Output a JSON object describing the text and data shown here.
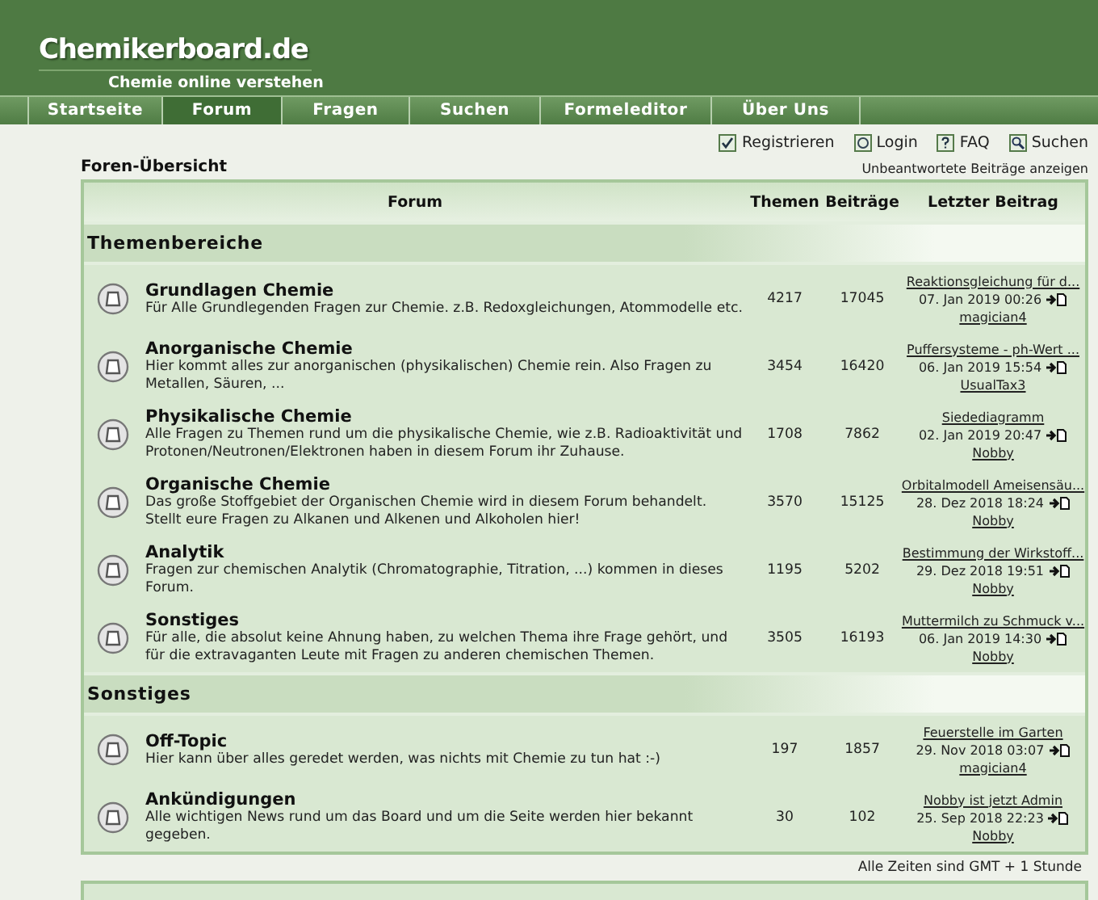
{
  "site": {
    "title": "Chemikerboard.de",
    "tagline": "Chemie online verstehen"
  },
  "nav": [
    {
      "label": "Startseite",
      "selected": false
    },
    {
      "label": "Forum",
      "selected": true
    },
    {
      "label": "Fragen",
      "selected": false
    },
    {
      "label": "Suchen",
      "selected": false
    },
    {
      "label": "Formeleditor",
      "selected": false
    },
    {
      "label": "Über Uns",
      "selected": false
    }
  ],
  "top_links": [
    {
      "label": "Registrieren",
      "kind": "register"
    },
    {
      "label": "Login",
      "kind": "login"
    },
    {
      "label": "FAQ",
      "kind": "faq"
    },
    {
      "label": "Suchen",
      "kind": "search"
    }
  ],
  "page_title": "Foren-Übersicht",
  "unanswered_link": "Unbeantwortete Beiträge anzeigen",
  "table": {
    "columns": [
      "Forum",
      "Themen",
      "Beiträge",
      "Letzter Beitrag"
    ],
    "categories": [
      {
        "title": "Themenbereiche",
        "forums": [
          {
            "title": "Grundlagen Chemie",
            "description": "Für Alle Grundlegenden Fragen zur Chemie. z.B. Redoxgleichungen, Atommodelle etc.",
            "topics": "4217",
            "posts": "17045",
            "last_post": {
              "title": "Reaktionsgleichung für d...",
              "date": "07. Jan 2019 00:26",
              "user": "magician4"
            }
          },
          {
            "title": "Anorganische Chemie",
            "description": "Hier kommt alles zur anorganischen (physikalischen) Chemie rein. Also Fragen zu Metallen, Säuren, ...",
            "topics": "3454",
            "posts": "16420",
            "last_post": {
              "title": "Puffersysteme - ph-Wert ...",
              "date": "06. Jan 2019 15:54",
              "user": "UsualTax3"
            }
          },
          {
            "title": "Physikalische Chemie",
            "description": "Alle Fragen zu Themen rund um die physikalische Chemie, wie z.B. Radioaktivität und Protonen/Neutronen/Elektronen haben in diesem Forum ihr Zuhause.",
            "topics": "1708",
            "posts": "7862",
            "last_post": {
              "title": "Siedediagramm",
              "date": "02. Jan 2019 20:47",
              "user": "Nobby"
            }
          },
          {
            "title": "Organische Chemie",
            "description": "Das große Stoffgebiet der Organischen Chemie wird in diesem Forum behandelt. Stellt eure Fragen zu Alkanen und Alkenen und Alkoholen hier!",
            "topics": "3570",
            "posts": "15125",
            "last_post": {
              "title": "Orbitalmodell Ameisensäu...",
              "date": "28. Dez 2018 18:24",
              "user": "Nobby"
            }
          },
          {
            "title": "Analytik",
            "description": "Fragen zur chemischen Analytik (Chromatographie, Titration, ...) kommen in dieses Forum.",
            "topics": "1195",
            "posts": "5202",
            "last_post": {
              "title": "Bestimmung der Wirkstoff...",
              "date": "29. Dez 2018 19:51",
              "user": "Nobby"
            }
          },
          {
            "title": "Sonstiges",
            "description": "Für alle, die absolut keine Ahnung haben, zu welchen Thema ihre Frage gehört, und für die extravaganten Leute mit Fragen zu anderen chemischen Themen.",
            "topics": "3505",
            "posts": "16193",
            "last_post": {
              "title": "Muttermilch zu Schmuck v...",
              "date": "06. Jan 2019 14:30",
              "user": "Nobby"
            }
          }
        ]
      },
      {
        "title": "Sonstiges",
        "forums": [
          {
            "title": "Off-Topic",
            "description": "Hier kann über alles geredet werden, was nichts mit Chemie zu tun hat :-)",
            "topics": "197",
            "posts": "1857",
            "last_post": {
              "title": "Feuerstelle im Garten",
              "date": "29. Nov 2018 03:07",
              "user": "magician4"
            }
          },
          {
            "title": "Ankündigungen",
            "description": "Alle wichtigen News rund um das Board und um die Seite werden hier bekannt gegeben.",
            "topics": "30",
            "posts": "102",
            "last_post": {
              "title": "Nobby ist jetzt Admin",
              "date": "25. Sep 2018 22:23",
              "user": "Nobby"
            }
          }
        ]
      }
    ]
  },
  "footer_note": "Alle Zeiten sind GMT + 1 Stunde"
}
